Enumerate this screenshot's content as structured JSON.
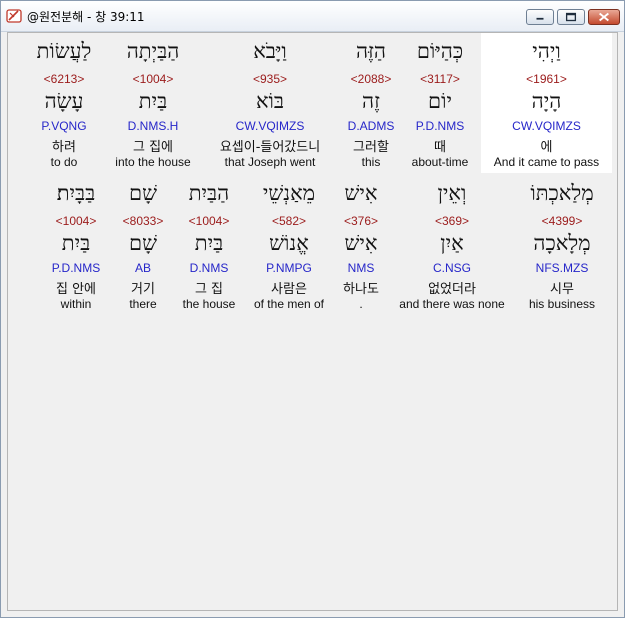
{
  "window": {
    "title": "@원전분해 - 창 39:11",
    "icon": "bible-app-icon"
  },
  "colors": {
    "strong": "#9b1b1b",
    "morph": "#2626c9",
    "highlight_bg": "#ffffff"
  },
  "verse": {
    "row1": [
      {
        "heb": "וַיְהִי",
        "strong": "<1961>",
        "lemma": "הָיָה",
        "morph": "CW.VQIMZS",
        "korean": "에",
        "english": "And it came to pass"
      },
      {
        "heb": "כְּהַיּוֹם",
        "strong": "<3117>",
        "lemma": "יוֹם",
        "morph": "P.D.NMS",
        "korean": "때",
        "english": "about-time"
      },
      {
        "heb": "הַזֶּה",
        "strong": "<2088>",
        "lemma": "זֶה",
        "morph": "D.ADMS",
        "korean": "그러할",
        "english": "this"
      },
      {
        "heb": "וַיָּבֹא",
        "strong": "<935>",
        "lemma": "בּוֹא",
        "morph": "CW.VQIMZS",
        "korean": "요셉이-들어갔드니",
        "english": "that Joseph went"
      },
      {
        "heb": "הַבַּיְתָה",
        "strong": "<1004>",
        "lemma": "בַּיִת",
        "morph": "D.NMS.H",
        "korean": "그 집에",
        "english": "into the house"
      },
      {
        "heb": "לַעֲשׂוֹת",
        "strong": "<6213>",
        "lemma": "עָשָׂה",
        "morph": "P.VQNG",
        "korean": "하려",
        "english": "to do"
      }
    ],
    "row2": [
      {
        "heb": "מְלַאכְתּוֹ",
        "strong": "<4399>",
        "lemma": "מְלָאכָה",
        "morph": "NFS.MZS",
        "korean": "시무",
        "english": "his business"
      },
      {
        "heb": "וְאֵין",
        "strong": "<369>",
        "lemma": "אַיִן",
        "morph": "C.NSG",
        "korean": "없었더라",
        "english": "and there was none"
      },
      {
        "heb": "אִישׁ",
        "strong": "<376>",
        "lemma": "אִישׁ",
        "morph": "NMS",
        "korean": "하나도",
        "english": "."
      },
      {
        "heb": "מֵאַנְשֵׁי",
        "strong": "<582>",
        "lemma": "אֱנוֹשׁ",
        "morph": "P.NMPG",
        "korean": "사람은",
        "english": "of the men of"
      },
      {
        "heb": "הַבַּיִת",
        "strong": "<1004>",
        "lemma": "בַּיִת",
        "morph": "D.NMS",
        "korean": "그 집",
        "english": "the house"
      },
      {
        "heb": "שָׁם",
        "strong": "<8033>",
        "lemma": "שָׁם",
        "morph": "AB",
        "korean": "거기",
        "english": "there"
      },
      {
        "heb": "בַּבָּיִת׃",
        "strong": "<1004>",
        "lemma": "בַּיִת",
        "morph": "P.D.NMS",
        "korean": "집 안에",
        "english": "within"
      }
    ]
  }
}
